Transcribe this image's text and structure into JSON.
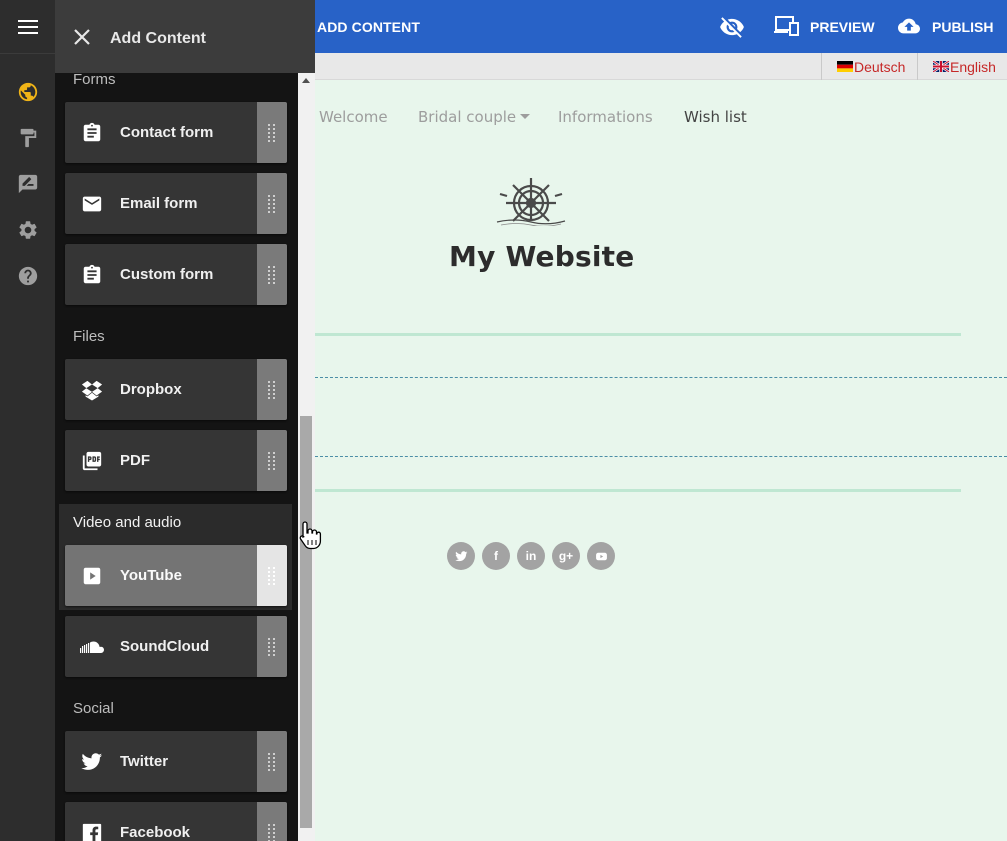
{
  "topbar": {
    "title": "ADD CONTENT",
    "hide_icon": "eye-off-icon",
    "preview_label": "PREVIEW",
    "publish_label": "PUBLISH",
    "background": "#2862c7"
  },
  "languages": [
    {
      "label": "Deutsch",
      "flag": "germany-flag-icon"
    },
    {
      "label": "English",
      "flag": "uk-flag-icon"
    }
  ],
  "rail": {
    "icons": [
      "globe-icon",
      "paint-roller-icon",
      "edit-note-icon",
      "gear-icon",
      "help-icon"
    ],
    "active_color": "#f0b417"
  },
  "panel": {
    "title": "Add Content",
    "sections": {
      "forms": "Forms",
      "files": "Files",
      "video_audio": "Video and audio",
      "social": "Social"
    },
    "items": {
      "contact_form": "Contact form",
      "email_form": "Email form",
      "custom_form": "Custom form",
      "dropbox": "Dropbox",
      "pdf": "PDF",
      "youtube": "YouTube",
      "soundcloud": "SoundCloud",
      "twitter": "Twitter",
      "facebook": "Facebook"
    },
    "hovered_item": "youtube"
  },
  "site": {
    "nav": [
      {
        "label": "Welcome"
      },
      {
        "label": "Bridal couple",
        "dropdown": true
      },
      {
        "label": "Informations"
      },
      {
        "label": "Wish list",
        "active": true
      }
    ],
    "title": "My Website",
    "logo_icon": "ship-wheel-icon",
    "socials": [
      "twitter-icon",
      "facebook-icon",
      "linkedin-icon",
      "google-plus-icon",
      "youtube-icon"
    ],
    "background": "#e8f6ec"
  }
}
